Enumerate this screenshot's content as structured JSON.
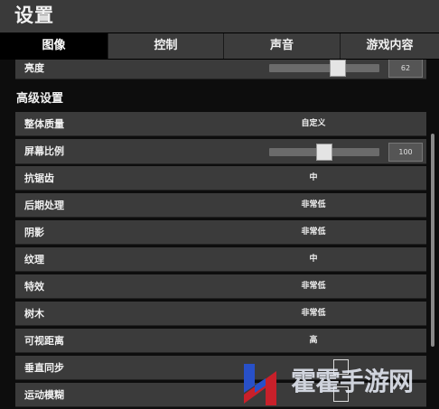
{
  "header": {
    "title": "设置"
  },
  "tabs": [
    {
      "label": "图像",
      "active": true
    },
    {
      "label": "控制",
      "active": false
    },
    {
      "label": "声音",
      "active": false
    },
    {
      "label": "游戏内容",
      "active": false
    }
  ],
  "brightness": {
    "label": "亮度",
    "value": 62,
    "min": 0,
    "max": 100
  },
  "section": {
    "title": "高级设置"
  },
  "settings": [
    {
      "label": "整体质量",
      "value": "自定义"
    },
    {
      "label": "屏幕比例",
      "value": "100"
    },
    {
      "label": "抗锯齿",
      "value": "中"
    },
    {
      "label": "后期处理",
      "value": "非常低"
    },
    {
      "label": "阴影",
      "value": "非常低"
    },
    {
      "label": "纹理",
      "value": "中"
    },
    {
      "label": "特效",
      "value": "非常低"
    },
    {
      "label": "树木",
      "value": "非常低"
    },
    {
      "label": "可视距离",
      "value": "高"
    },
    {
      "label": "垂直同步",
      "value": ""
    },
    {
      "label": "运动模糊",
      "value": ""
    }
  ],
  "screen_scale": {
    "value": 100,
    "min": 50,
    "max": 150
  },
  "watermark": {
    "text": "霍霍手游网"
  },
  "colors": {
    "accent_red": "#c8202a",
    "accent_blue": "#2850c8"
  }
}
